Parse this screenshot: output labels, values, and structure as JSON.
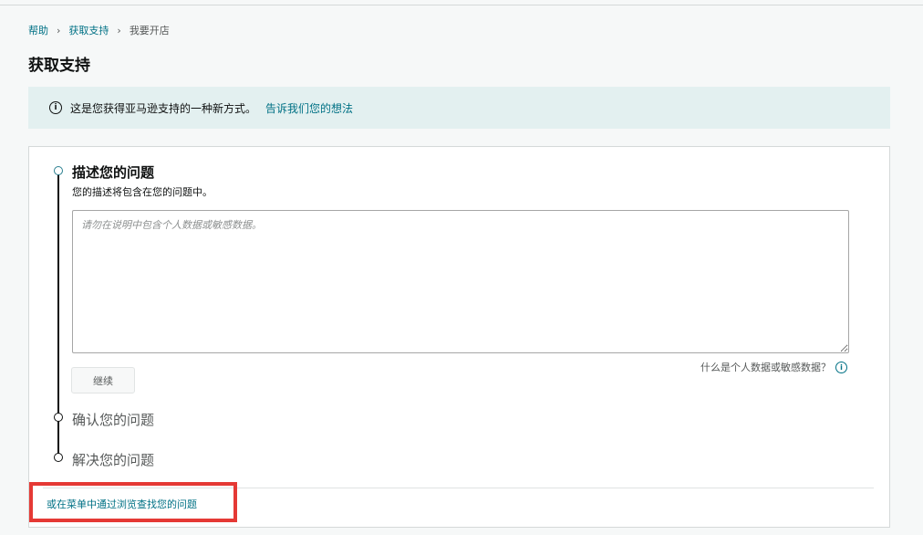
{
  "breadcrumb": {
    "items": [
      {
        "label": "帮助"
      },
      {
        "label": "获取支持"
      },
      {
        "label": "我要开店"
      }
    ],
    "separator": "›"
  },
  "page": {
    "title": "获取支持"
  },
  "banner": {
    "icon": "info-icon",
    "message": "这是您获得亚马逊支持的一种新方式。",
    "feedback_link": "告诉我们您的想法"
  },
  "steps": {
    "describe": {
      "title": "描述您的问题",
      "subtitle": "您的描述将包含在您的问题中。",
      "textarea_placeholder": "请勿在说明中包含个人数据或敏感数据。",
      "textarea_value": "",
      "continue_label": "继续",
      "sensitive_help": "什么是个人数据或敏感数据？"
    },
    "confirm": {
      "title": "确认您的问题"
    },
    "resolve": {
      "title": "解决您的问题"
    }
  },
  "footer": {
    "browse_link": "或在菜单中通过浏览查找您的问题"
  },
  "colors": {
    "link": "#007185",
    "banner_bg": "#e3f0f0",
    "highlight": "#e53935"
  }
}
